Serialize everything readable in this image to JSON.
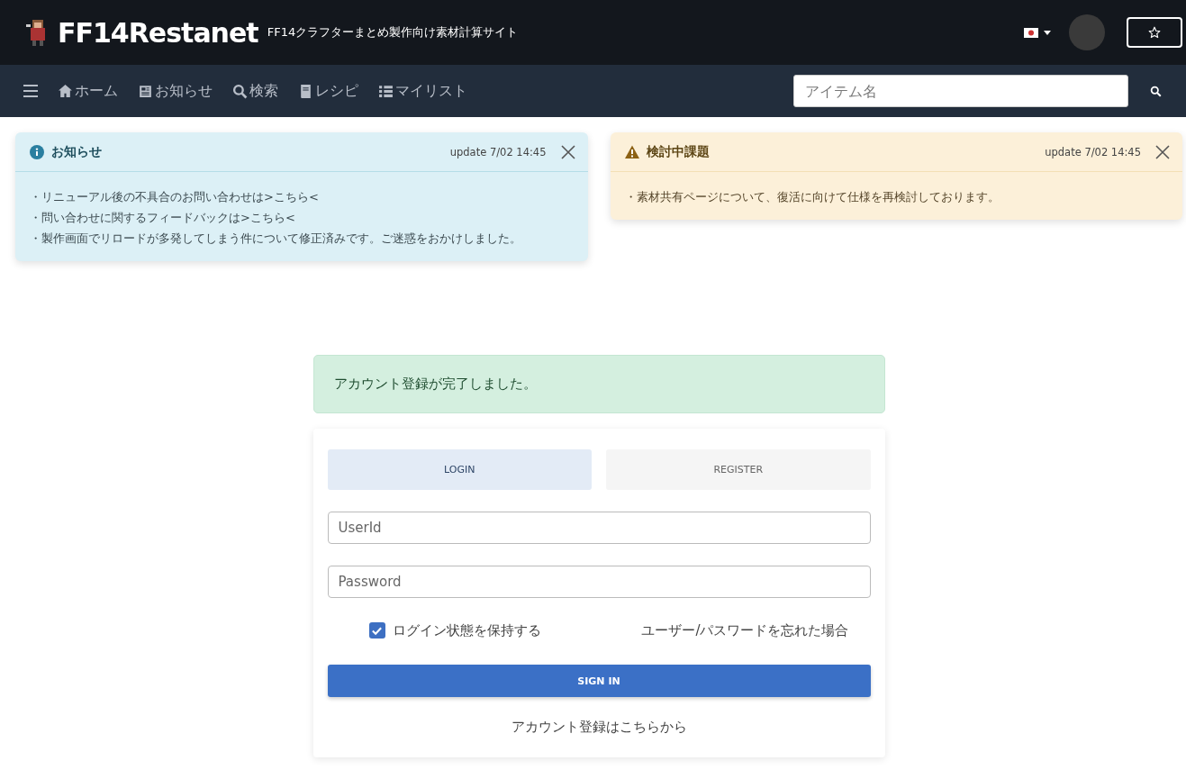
{
  "header": {
    "site_name": "FF14Restanet",
    "tagline": "FF14クラフターまとめ製作向け素材計算サイト"
  },
  "nav": {
    "items": [
      {
        "label": "ホーム"
      },
      {
        "label": "お知らせ"
      },
      {
        "label": "検索"
      },
      {
        "label": "レシピ"
      },
      {
        "label": "マイリスト"
      }
    ],
    "search": {
      "placeholder": "アイテム名"
    }
  },
  "notices": [
    {
      "kind": "info",
      "title": "お知らせ",
      "updated": "update 7/02 14:45",
      "lines": [
        "・リニューアル後の不具合のお問い合わせは>こちら<",
        "・問い合わせに関するフィードバックは>こちら<",
        "・製作画面でリロードが多発してしまう件について修正済みです。ご迷惑をおかけしました。"
      ]
    },
    {
      "kind": "warning",
      "title": "検討中課題",
      "updated": "update 7/02 14:45",
      "lines": [
        "・素材共有ページについて、復活に向けて仕様を再検討しております。"
      ]
    }
  ],
  "alert": "アカウント登録が完了しました。",
  "login": {
    "tabs": [
      {
        "label": "LOGIN",
        "selected": true
      },
      {
        "label": "REGISTER",
        "selected": false
      }
    ],
    "fields": [
      {
        "placeholder": "UserId"
      },
      {
        "placeholder": "Password"
      }
    ],
    "remember": {
      "label": "ログイン状態を保持する",
      "checked": true
    },
    "forgot": "ユーザー/パスワードを忘れた場合",
    "submit": "SIGN IN",
    "register_link": "アカウント登録はこちらから"
  }
}
